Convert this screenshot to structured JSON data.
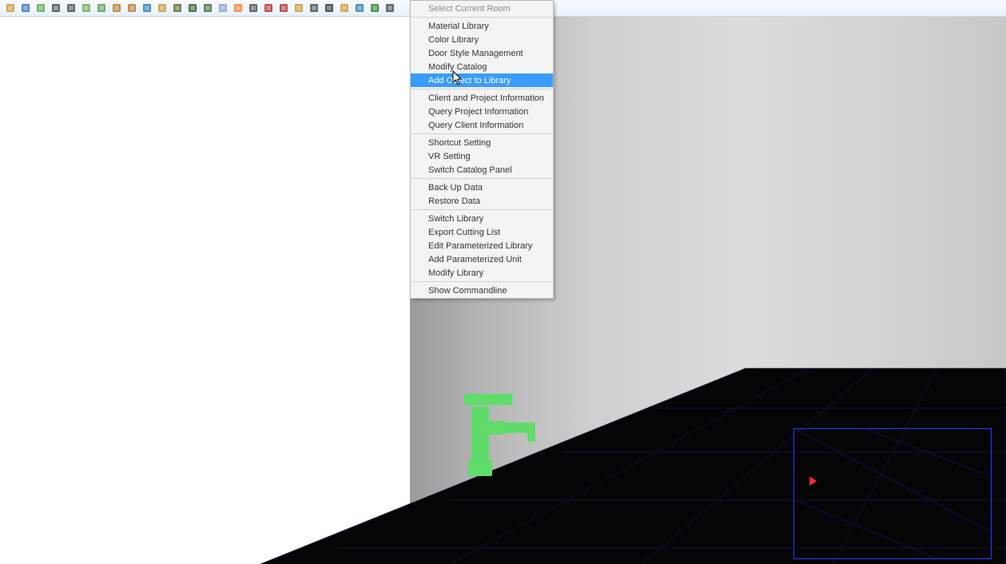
{
  "toolbar": {
    "icons": [
      "open-icon",
      "save-icon",
      "new-icon",
      "play-icon",
      "step-icon",
      "refresh-icon",
      "cycle-icon",
      "home-icon",
      "up-icon",
      "globe-icon",
      "window-icon",
      "panel-icon",
      "panel2-icon",
      "panel3-icon",
      "grid-icon",
      "node-icon",
      "down-icon",
      "axis-icon",
      "run-icon",
      "skip-icon",
      "loop-icon",
      "pointer-icon",
      "box-icon",
      "earth-icon",
      "tree-icon",
      "back-icon"
    ]
  },
  "menu": {
    "groups": [
      {
        "items": [
          {
            "key": "select_current_room",
            "label": "Select Current Room",
            "dim": true
          }
        ]
      },
      {
        "items": [
          {
            "key": "material_library",
            "label": "Material Library"
          },
          {
            "key": "color_library",
            "label": "Color Library"
          },
          {
            "key": "door_style_management",
            "label": "Door Style Management"
          },
          {
            "key": "modify_catalog",
            "label": "Modify Catalog"
          },
          {
            "key": "add_object_to_library",
            "label": "Add Object to Library",
            "highlighted": true
          }
        ]
      },
      {
        "items": [
          {
            "key": "client_project_info",
            "label": "Client and Project Information"
          },
          {
            "key": "query_project_info",
            "label": "Query Project Information"
          },
          {
            "key": "query_client_info",
            "label": "Query Client Information"
          }
        ]
      },
      {
        "items": [
          {
            "key": "shortcut_setting",
            "label": "Shortcut Setting"
          },
          {
            "key": "vr_setting",
            "label": "VR Setting"
          },
          {
            "key": "switch_catalog_panel",
            "label": "Switch Catalog Panel"
          }
        ]
      },
      {
        "items": [
          {
            "key": "back_up_data",
            "label": "Back Up Data"
          },
          {
            "key": "restore_data",
            "label": "Restore Data"
          }
        ]
      },
      {
        "items": [
          {
            "key": "switch_library",
            "label": "Switch Library"
          },
          {
            "key": "export_cutting_list",
            "label": "Export Cutting List"
          },
          {
            "key": "edit_param_library",
            "label": "Edit Parameterized Library"
          },
          {
            "key": "add_param_unit",
            "label": "Add Parameterized Unit"
          },
          {
            "key": "modify_library",
            "label": "Modify Library"
          }
        ]
      },
      {
        "items": [
          {
            "key": "show_commandline",
            "label": "Show Commandline"
          }
        ]
      }
    ]
  },
  "scene": {
    "selected_object": "faucet",
    "selection_color": "#5fdc6a"
  }
}
